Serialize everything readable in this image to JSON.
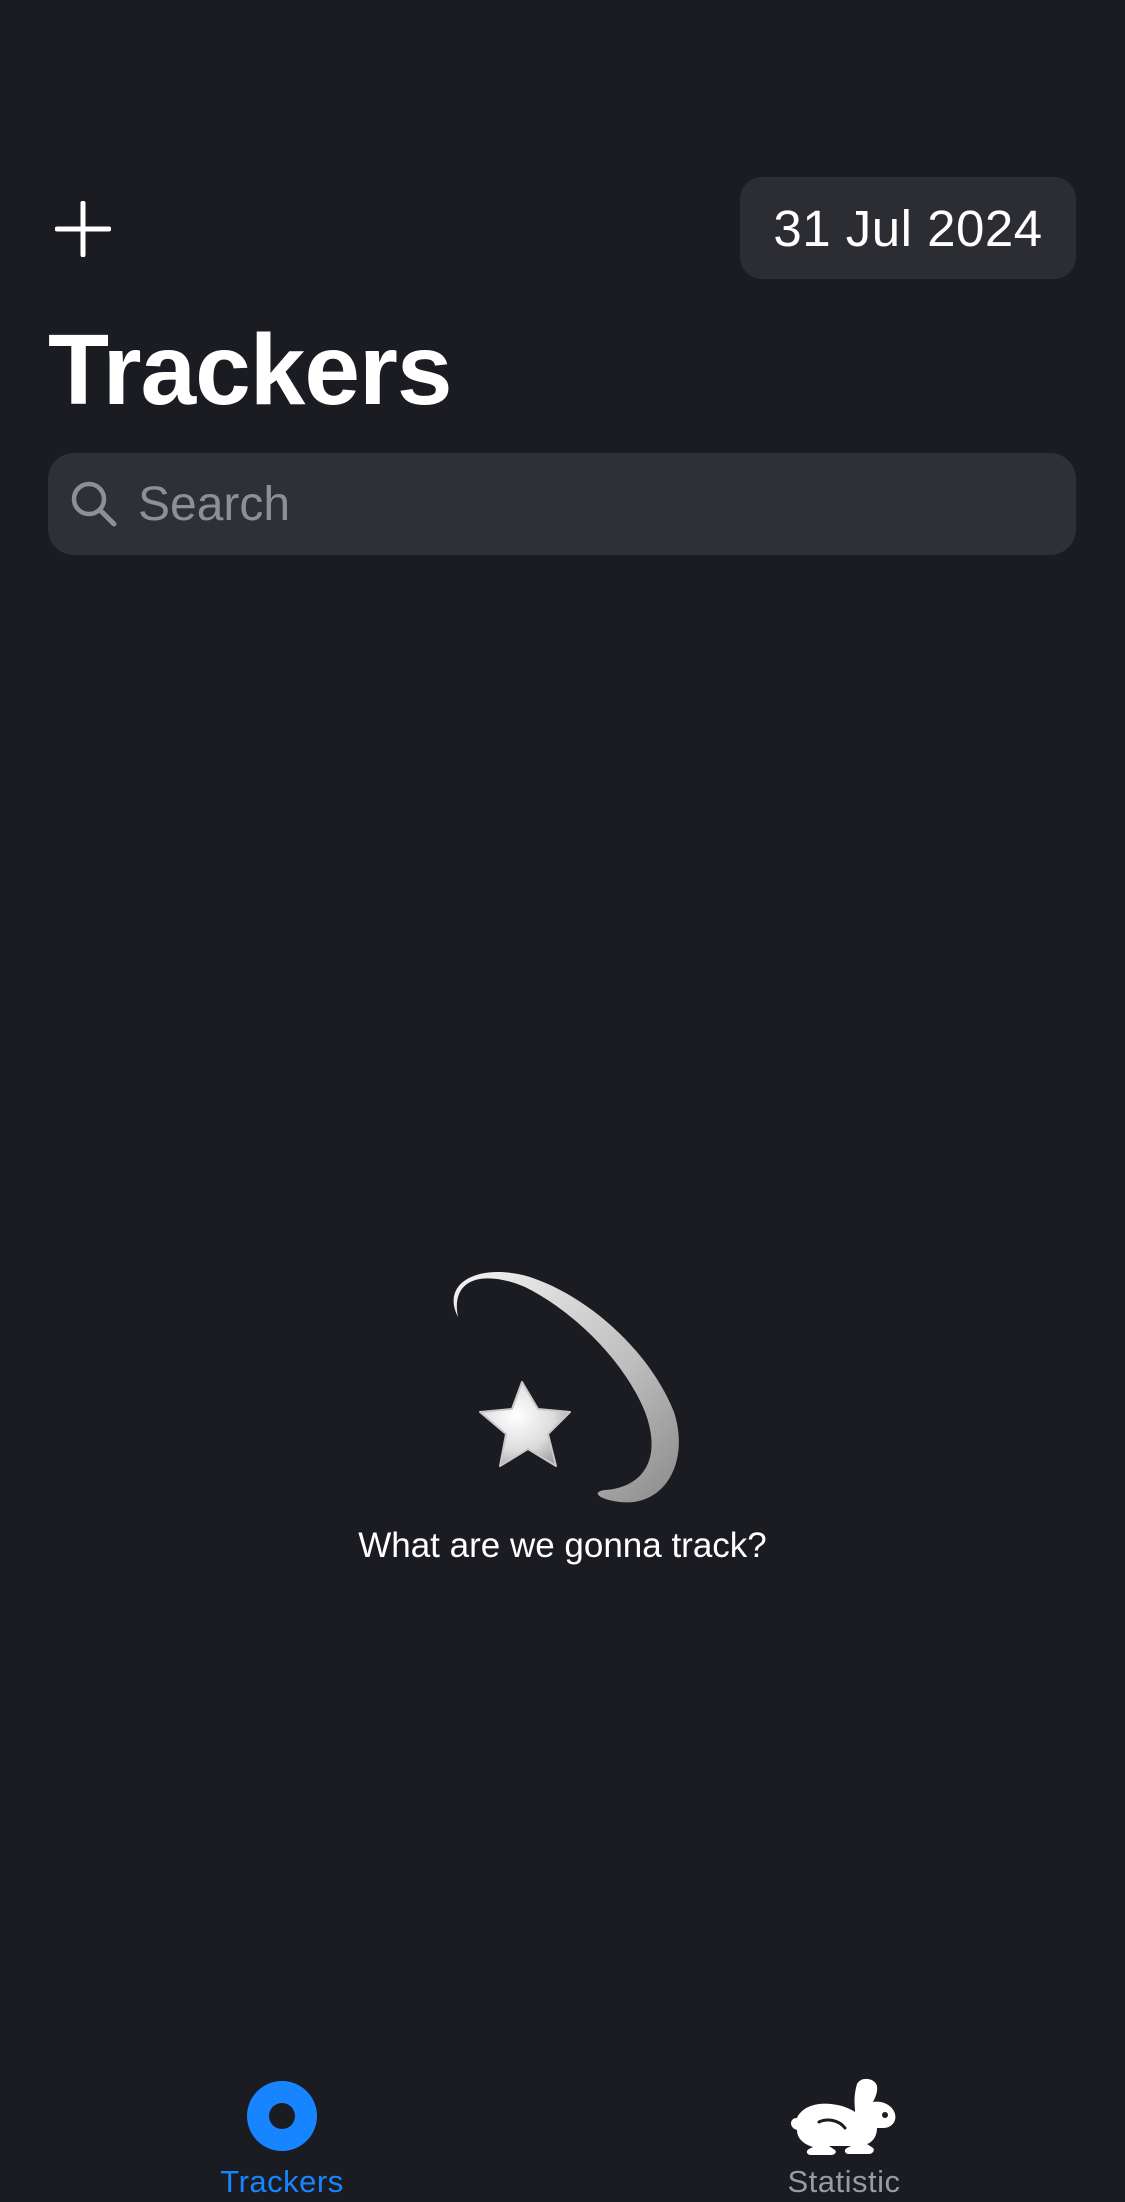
{
  "header": {
    "add_icon": "plus-icon",
    "date": "31 Jul 2024",
    "title": "Trackers"
  },
  "search": {
    "icon": "search-icon",
    "placeholder": "Search"
  },
  "empty_state": {
    "illustration": "dizzy-star-icon",
    "message": "What are we gonna track?"
  },
  "tab_bar": {
    "tabs": [
      {
        "label": "Trackers",
        "icon": "tracker-circle-icon",
        "active": true,
        "color": "#1785ff"
      },
      {
        "label": "Statistic",
        "icon": "rabbit-icon",
        "active": false,
        "color": "#9a9aa2"
      }
    ]
  },
  "colors": {
    "background": "#1b1b22",
    "surface": "#2c2c33",
    "accent": "#1785ff"
  }
}
